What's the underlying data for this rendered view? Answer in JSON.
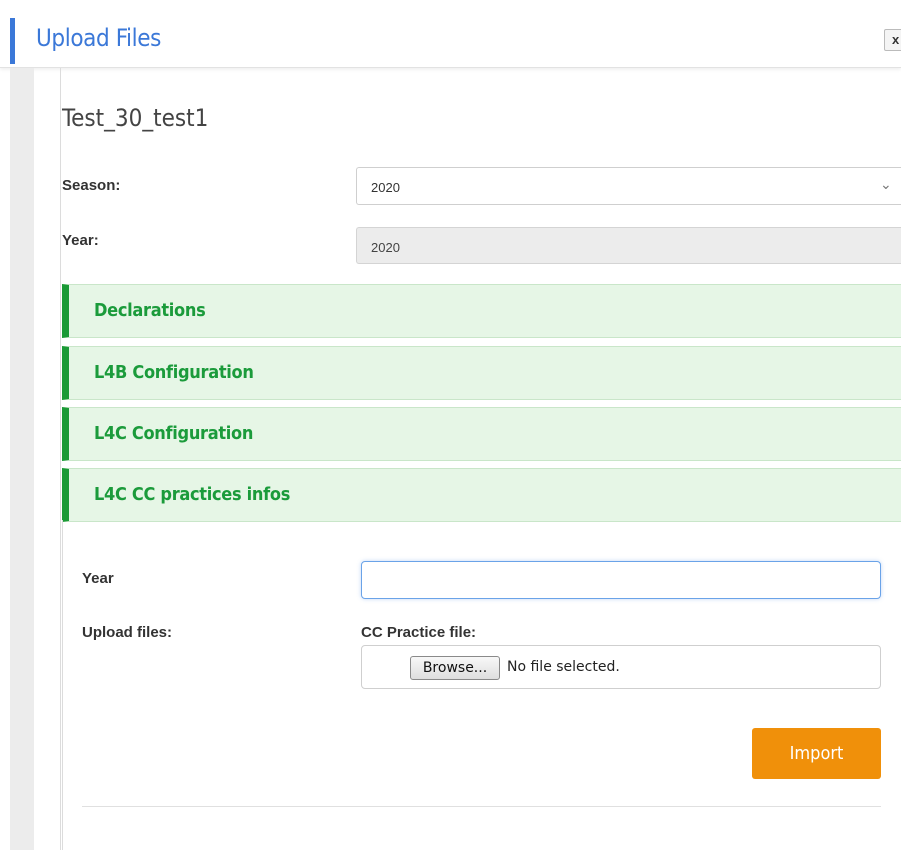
{
  "header": {
    "title": "Upload Files",
    "close_label": "x"
  },
  "site_title": "Test_30_test1",
  "season": {
    "label": "Season:",
    "value": "2020"
  },
  "year_field": {
    "label": "Year:",
    "value": "2020"
  },
  "accordion": [
    {
      "label": "Declarations"
    },
    {
      "label": "L4B Configuration"
    },
    {
      "label": "L4C Configuration"
    },
    {
      "label": "L4C CC practices infos"
    }
  ],
  "form": {
    "year_label": "Year",
    "year_value": "",
    "upload_label": "Upload files:",
    "file_label": "CC Practice file:",
    "browse_label": "Browse...",
    "file_status": "No file selected.",
    "import_label": "Import"
  },
  "colors": {
    "accent": "#3b78d8",
    "section_green": "#1a9a36",
    "import_orange": "#f0900a"
  }
}
